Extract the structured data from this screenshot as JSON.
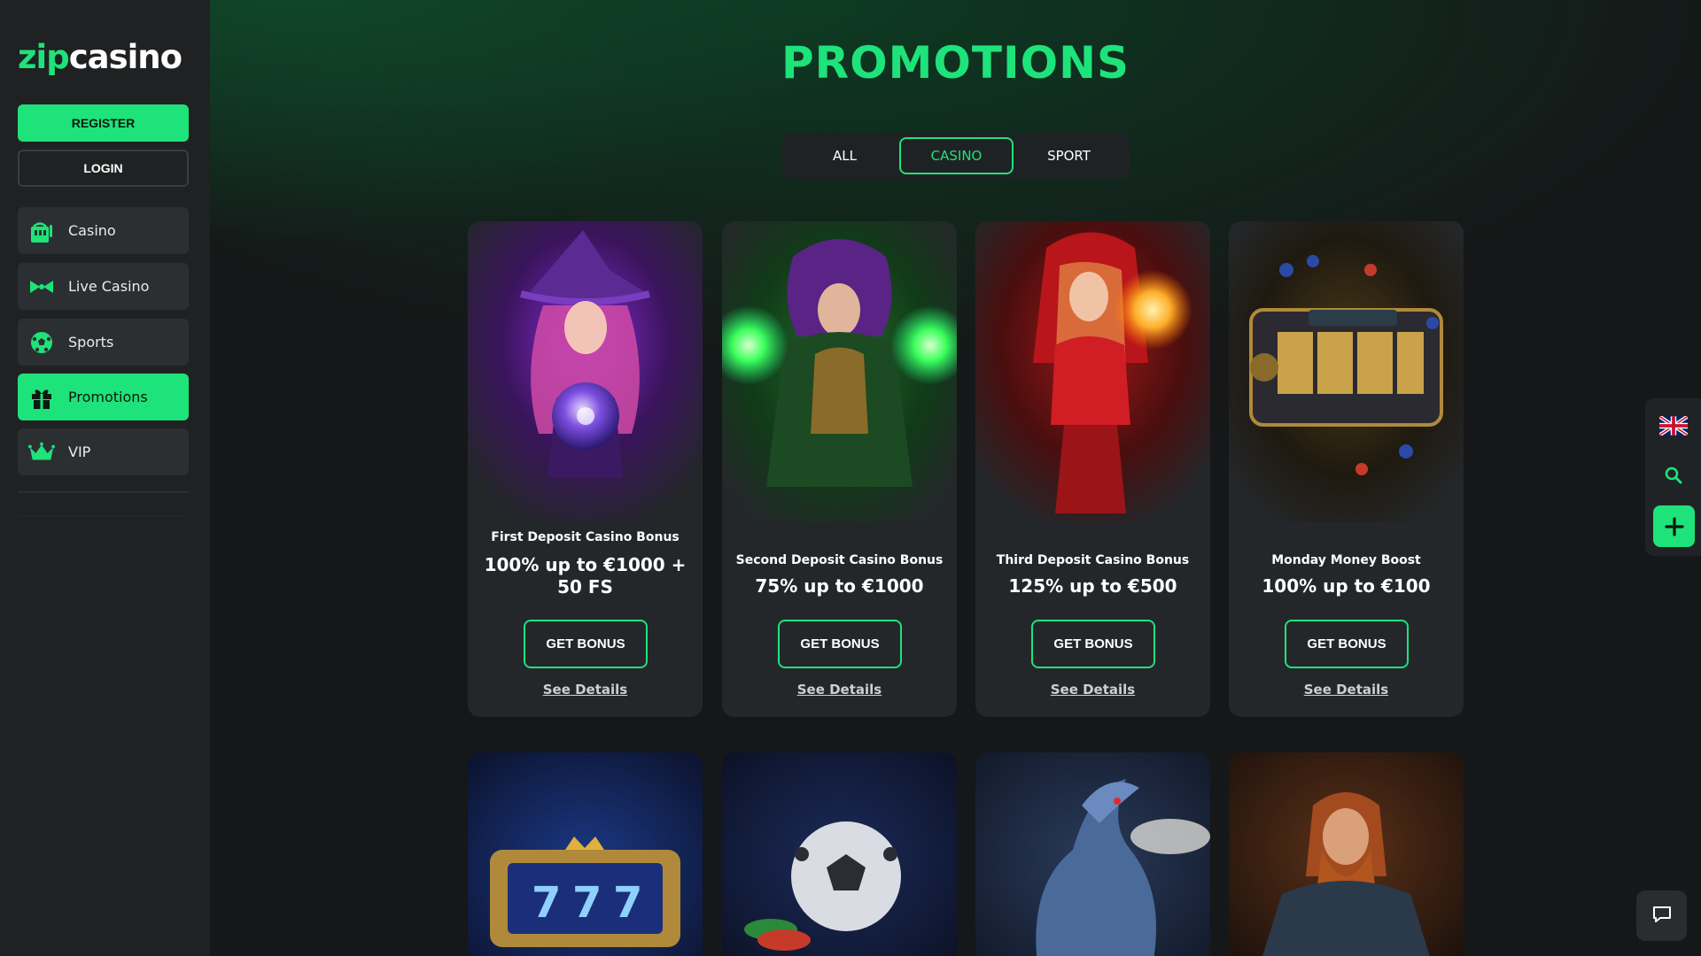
{
  "brand": {
    "logo_part1": "zip",
    "logo_part2": "casino",
    "accent": "#1ee37a"
  },
  "sidebar": {
    "register_label": "REGISTER",
    "login_label": "LOGIN",
    "items": [
      {
        "label": "Casino",
        "icon": "casino-icon",
        "active": false
      },
      {
        "label": "Live Casino",
        "icon": "live-casino-icon",
        "active": false
      },
      {
        "label": "Sports",
        "icon": "soccer-ball-icon",
        "active": false
      },
      {
        "label": "Promotions",
        "icon": "gift-icon",
        "active": true
      },
      {
        "label": "VIP",
        "icon": "crown-icon",
        "active": false
      }
    ]
  },
  "main": {
    "title": "PROMOTIONS",
    "filters": [
      {
        "label": "ALL",
        "active": false
      },
      {
        "label": "CASINO",
        "active": true
      },
      {
        "label": "SPORT",
        "active": false
      }
    ],
    "promotions": [
      {
        "subtitle": "First Deposit Casino Bonus",
        "amount": "100% up to €1000 + 50 FS",
        "cta": "GET BONUS",
        "details": "See Details",
        "art": "purple-witch"
      },
      {
        "subtitle": "Second Deposit Casino Bonus",
        "amount": "75% up to €1000",
        "cta": "GET BONUS",
        "details": "See Details",
        "art": "green-sorceress"
      },
      {
        "subtitle": "Third Deposit Casino Bonus",
        "amount": "125% up to €500",
        "cta": "GET BONUS",
        "details": "See Details",
        "art": "red-enchantress"
      },
      {
        "subtitle": "Monday Money Boost",
        "amount": "100% up to €100",
        "cta": "GET BONUS",
        "details": "See Details",
        "art": "slot-machine"
      }
    ],
    "second_row_art": [
      "777-slot-machine",
      "soccer-ball-chips",
      "blue-dragon",
      "viking-warrior"
    ]
  },
  "float_bar": {
    "language_icon": "uk-flag-icon",
    "search_icon": "search-icon",
    "add_icon": "plus-icon"
  },
  "chat": {
    "icon": "chat-icon"
  }
}
